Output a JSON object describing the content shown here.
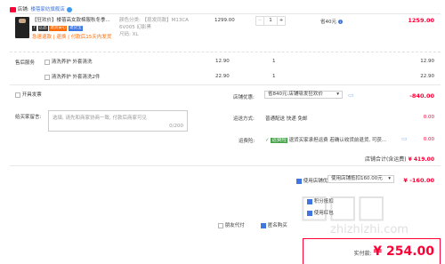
{
  "shop": {
    "prefix": "店铺:",
    "name": "楼蓓家纺旗舰店"
  },
  "product": {
    "title": "【狂欢价】楼蓓高女款棉服秋冬季...",
    "tags": [
      "7",
      "正品",
      "退货安心",
      "退货宝"
    ],
    "promo": "急速退款 | 退换 | 付款后15天内发货",
    "attrs": [
      "颜色分类: 【现发同款】M13CA",
      "6V005 幻影黑",
      "尺码: XL"
    ],
    "price": "1299.00",
    "qty": "1",
    "discount": "省40元",
    "discount_icon": "i",
    "total": "1259.00"
  },
  "services": {
    "label": "售后服务",
    "items": [
      {
        "name": "清洗养护 外套清洗",
        "price": "12.90",
        "qty": "1",
        "total": "12.90"
      },
      {
        "name": "清洗养护 外套清洗2件",
        "price": "22.90",
        "qty": "1",
        "total": "22.90"
      }
    ]
  },
  "invoice": {
    "label": "开具发票"
  },
  "message": {
    "label": "给买家留言:",
    "placeholder": "选填, 请先和商家协商一致, 付款后商家可见",
    "counter": "0/200"
  },
  "shop_discount": {
    "label": "店铺优惠:",
    "value": "省840元:店铺吸发狂欢价",
    "amount": "-840.00"
  },
  "service_fee": {
    "label": "运送方式:",
    "text": "普通配送 快递 免邮",
    "amount": "0.00"
  },
  "shipping_ins": {
    "label": "运费险:",
    "badge": "运费险",
    "text": "退货买家承担运费 若确认收货前退货, 可获...",
    "amount": "0.00"
  },
  "subtotal": {
    "label": "店铺合计(含运费)",
    "amount": "¥ 419.00"
  },
  "coupon": {
    "label": "使用店铺优惠",
    "value": "使用店铺抵扣160.00元",
    "amount": "¥ -160.00"
  },
  "rows": [
    {
      "label": "积分抵扣"
    },
    {
      "label": "使用红包"
    }
  ],
  "footer": {
    "anonymous": "匿名购买",
    "proxy": "朋友代付",
    "total_label": "实付款:",
    "total": "¥ 254.00",
    "watermark": "zhizhizhi.com"
  },
  "colors": {
    "accent": "#ff0036",
    "blue": "#3f76e0",
    "badge_green": "#45a147"
  }
}
